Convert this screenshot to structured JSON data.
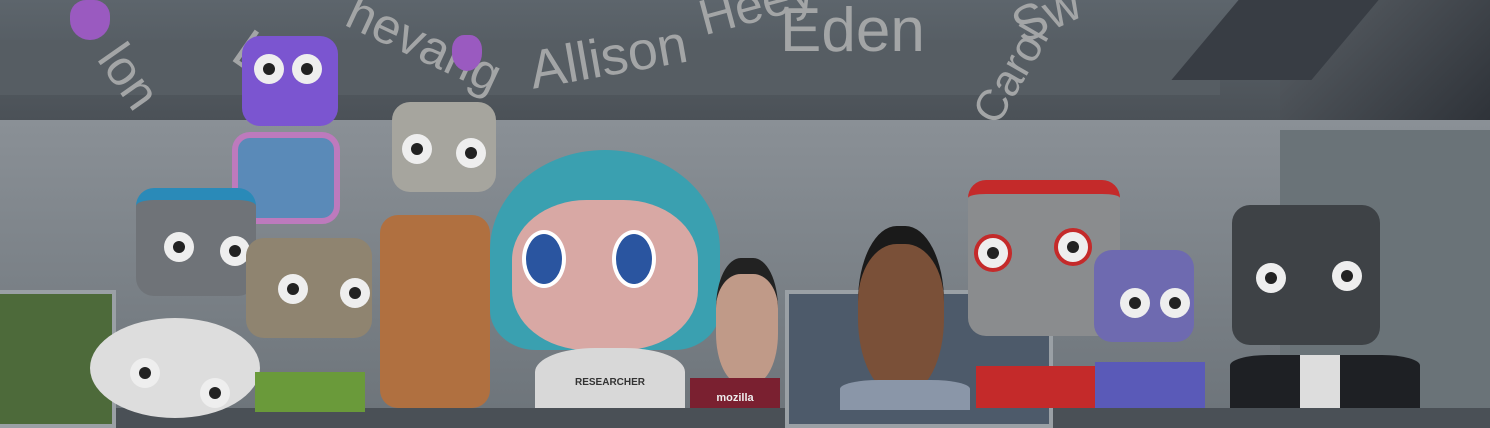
{
  "scene": {
    "name_tags": [
      "lon",
      "Lee",
      "hevang",
      "Allison",
      "Heey",
      "Eden",
      "Carol",
      "Sw"
    ],
    "shirt_texts": {
      "researcher": "RESEARCHER",
      "mozilla": "mozilla"
    },
    "colors": {
      "ceiling": "#565d63",
      "wall": "#7e858b",
      "avatar_hair": "#3aa0b0",
      "robot_red": "#c42a2a",
      "robot_purple": "#7b55d0"
    }
  }
}
